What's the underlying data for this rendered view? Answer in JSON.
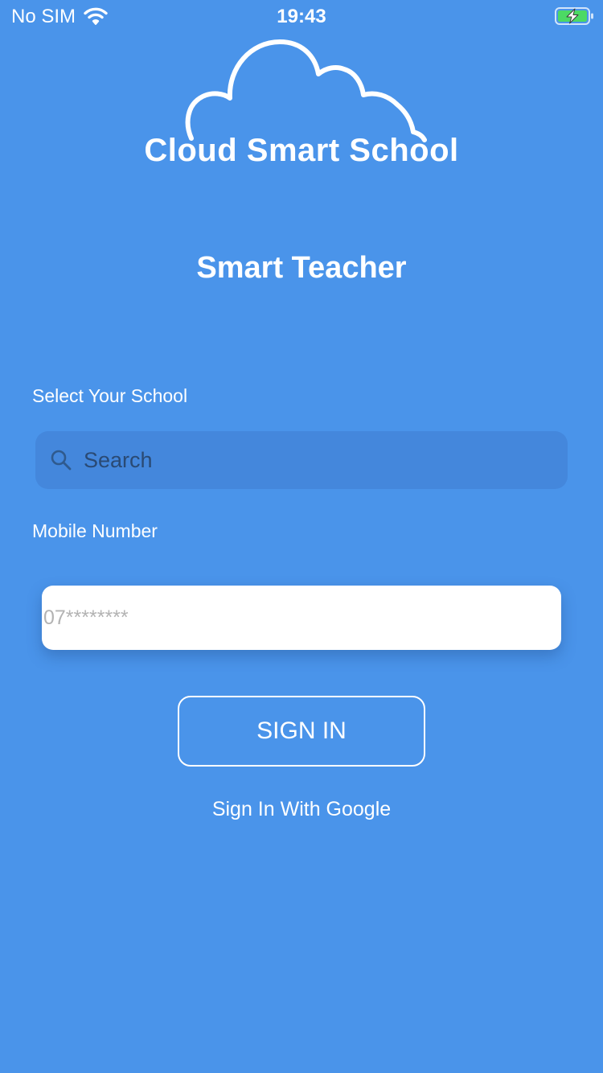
{
  "status_bar": {
    "carrier": "No SIM",
    "time": "19:43",
    "wifi_icon": "wifi-icon",
    "battery_icon": "battery-charging-icon"
  },
  "logo": {
    "text": "Cloud Smart School",
    "icon": "cloud-icon"
  },
  "app_title": "Smart Teacher",
  "school_field": {
    "label": "Select Your School",
    "placeholder": "Search",
    "icon": "search-icon"
  },
  "mobile_field": {
    "label": "Mobile Number",
    "placeholder": "07********"
  },
  "buttons": {
    "sign_in": "SIGN IN",
    "google_sign_in": "Sign In With Google"
  },
  "colors": {
    "background": "#4a94ea",
    "search_field": "#4487dc",
    "battery_fill": "#4cd964"
  }
}
